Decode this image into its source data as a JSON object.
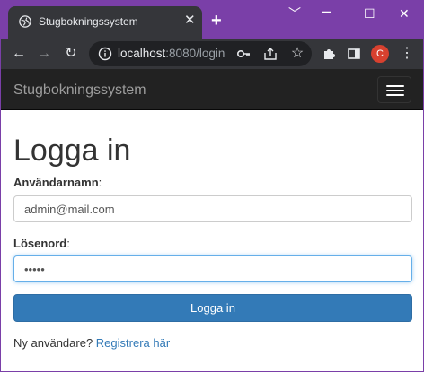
{
  "browser": {
    "tab_title": "Stugbokningssystem",
    "url_host": "localhost",
    "url_rest": ":8080/login",
    "profile_initial": "C"
  },
  "navbar": {
    "brand": "Stugbokningssystem"
  },
  "login": {
    "heading": "Logga in",
    "username_label": "Användarnamn",
    "username_value": "admin@mail.com",
    "password_label": "Lösenord",
    "password_value": "•••••",
    "submit_label": "Logga in",
    "new_user_text": "Ny användare?",
    "register_link": "Registrera här"
  },
  "colors": {
    "titlebar": "#7a3fa8",
    "navbar": "#222222",
    "primary": "#337ab7"
  }
}
